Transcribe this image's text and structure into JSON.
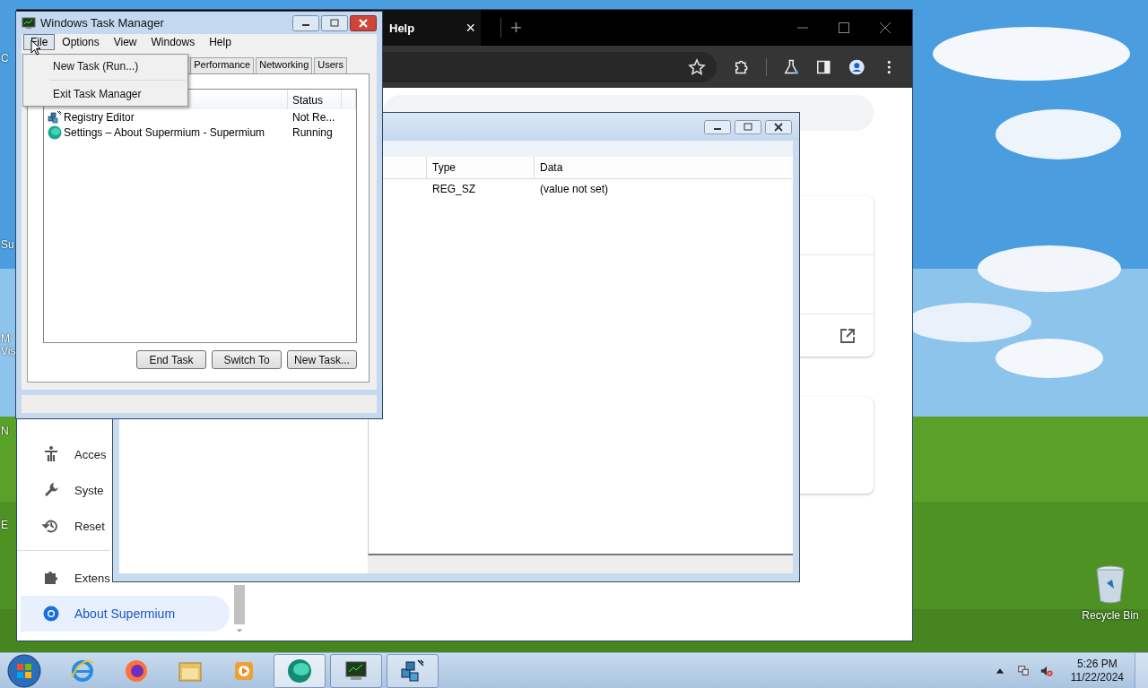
{
  "desktop": {
    "icon_fragments": [
      {
        "label": "C"
      },
      {
        "label": "Su"
      },
      {
        "label": "M"
      },
      {
        "label": "Vis"
      },
      {
        "label": "N"
      },
      {
        "label": "E"
      }
    ],
    "recycle_bin": {
      "label": "Recycle Bin"
    }
  },
  "browser": {
    "tab": {
      "title": "Help",
      "close": "×"
    },
    "new_tab": "+",
    "sidebar": {
      "items": [
        {
          "kind": "accessibility",
          "label": "Acces",
          "selected": false
        },
        {
          "kind": "system",
          "label": "Syste",
          "selected": false
        },
        {
          "kind": "reset",
          "label": "Reset",
          "selected": false
        },
        {
          "kind": "extensions",
          "label": "Extens",
          "selected": false
        },
        {
          "kind": "about",
          "label": "About Supermium",
          "selected": true
        }
      ]
    }
  },
  "registry_editor": {
    "columns": [
      "Type",
      "Data"
    ],
    "rows": [
      {
        "type": "REG_SZ",
        "data": "(value not set)"
      }
    ]
  },
  "task_manager": {
    "title": "Windows Task Manager",
    "menus": [
      {
        "label": "File",
        "selected": true
      },
      {
        "label": "Options",
        "selected": false
      },
      {
        "label": "View",
        "selected": false
      },
      {
        "label": "Windows",
        "selected": false
      },
      {
        "label": "Help",
        "selected": false
      }
    ],
    "file_menu": [
      "New Task (Run...)",
      "Exit Task Manager"
    ],
    "tabs": [
      {
        "label": "Performance",
        "selected": false
      },
      {
        "label": "Networking",
        "selected": false
      },
      {
        "label": "Users",
        "selected": false
      }
    ],
    "columns": [
      "Status"
    ],
    "rows": [
      {
        "kind": "regedit",
        "task": "Registry Editor",
        "status": "Not Re..."
      },
      {
        "kind": "browser",
        "task": "Settings – About Supermium - Supermium",
        "status": "Running"
      }
    ],
    "buttons": [
      "End Task",
      "Switch To",
      "New Task..."
    ]
  },
  "taskbar": {
    "clock": {
      "time": "5:26 PM",
      "date": "11/22/2024"
    }
  }
}
